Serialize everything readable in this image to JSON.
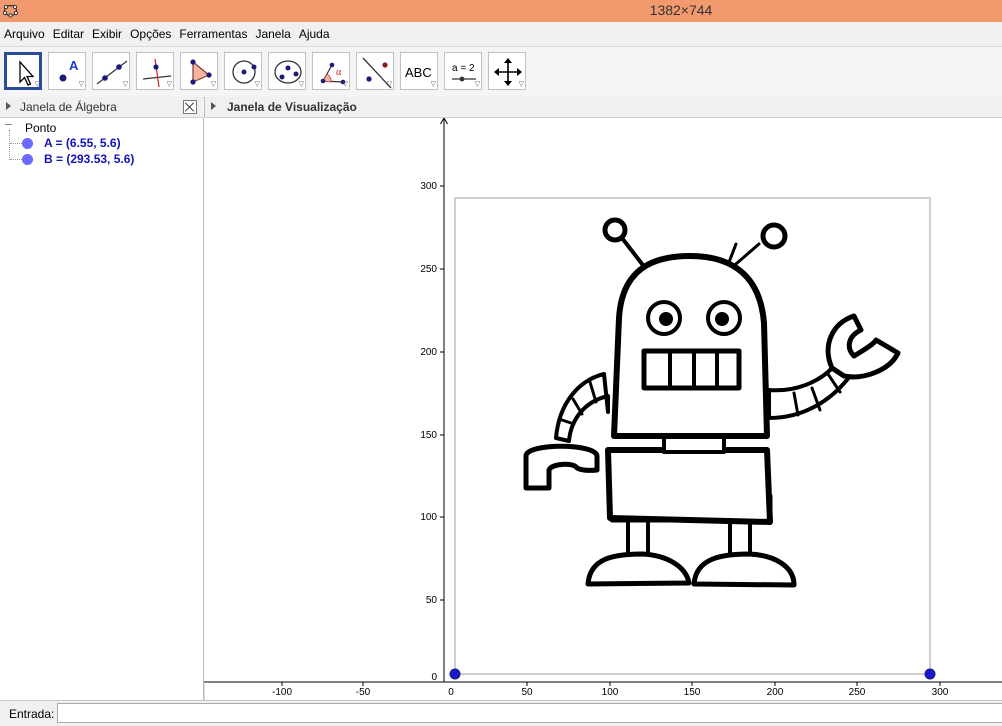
{
  "window": {
    "title": "1382×744"
  },
  "menu": [
    "Arquivo",
    "Editar",
    "Exibir",
    "Opções",
    "Ferramentas",
    "Janela",
    "Ajuda"
  ],
  "toolbar": {
    "tools": [
      {
        "icon": "move-arrow-icon",
        "selected": true
      },
      {
        "icon": "new-point-icon",
        "label": "A"
      },
      {
        "icon": "line-through-two-points-icon"
      },
      {
        "icon": "perpendicular-line-icon"
      },
      {
        "icon": "polygon-icon"
      },
      {
        "icon": "circle-center-point-icon"
      },
      {
        "icon": "circle-three-points-icon"
      },
      {
        "icon": "angle-icon",
        "label": "α"
      },
      {
        "icon": "reflect-about-line-icon"
      },
      {
        "icon": "text-icon",
        "label": "ABC"
      },
      {
        "icon": "slider-icon",
        "label": "a = 2"
      },
      {
        "icon": "move-graphics-view-icon"
      }
    ]
  },
  "algebra": {
    "title": "Janela de Álgebra",
    "group": "Ponto",
    "points": [
      {
        "label": "A = (6.55, 5.6)",
        "color": "#6b6bff"
      },
      {
        "label": "B = (293.53, 5.6)",
        "color": "#6b6bff"
      }
    ]
  },
  "graphics": {
    "title": "Janela de Visualização",
    "x_ticks": [
      "-100",
      "-50",
      "0",
      "50",
      "100",
      "150",
      "200",
      "250",
      "300"
    ],
    "y_ticks": [
      "300",
      "250",
      "200",
      "150",
      "100",
      "50",
      "0"
    ],
    "point_color": "#1a1acc"
  },
  "input": {
    "label": "Entrada:",
    "value": ""
  }
}
